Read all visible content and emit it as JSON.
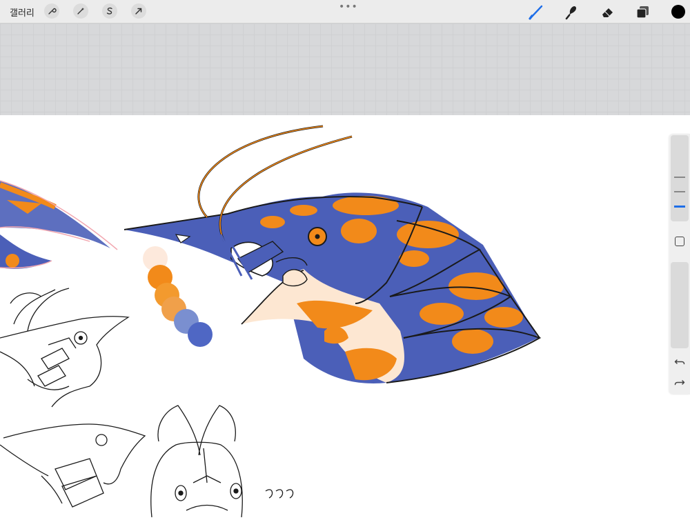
{
  "toolbar": {
    "gallery_label": "갤러리",
    "left_tools": [
      "wrench-icon",
      "magic-wand-icon",
      "selection-s-icon",
      "transform-arrow-icon"
    ],
    "grip_label": "•••",
    "right_tools": [
      "brush-icon",
      "smudge-icon",
      "eraser-icon",
      "layers-icon"
    ],
    "current_color": "#000000"
  },
  "canvas": {
    "background": "#ffffff",
    "palette_swatches": [
      "#fde9dc",
      "#f28a1a",
      "#f39a2e",
      "#f0a04a",
      "#7a8fd0",
      "#4f67c4"
    ],
    "colors": {
      "blue": "#4b5fb8",
      "orange": "#f28a1a",
      "cream": "#fde7d2",
      "ink": "#1a1a1a"
    }
  },
  "sidebar": {
    "icons": [
      "modify-square-icon",
      "undo-icon",
      "redo-icon"
    ],
    "accent": "#1e6ee8"
  }
}
